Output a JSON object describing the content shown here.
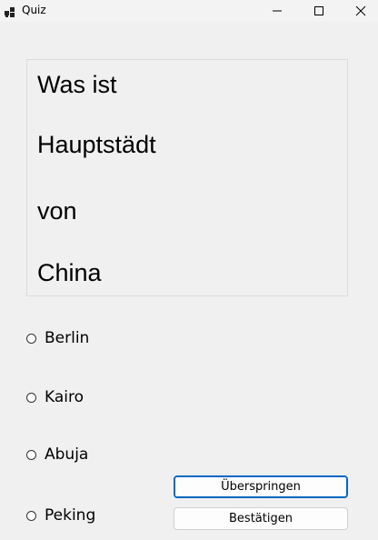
{
  "window": {
    "title": "Quiz"
  },
  "question": {
    "lines": [
      "Was ist",
      "Hauptstädt",
      "von",
      "China"
    ]
  },
  "options": [
    {
      "label": "Berlin"
    },
    {
      "label": "Kairo"
    },
    {
      "label": "Abuja"
    },
    {
      "label": "Peking"
    }
  ],
  "buttons": {
    "skip_label": "Überspringen",
    "confirm_label": "Bestätigen"
  },
  "colors": {
    "accent": "#0067c0"
  }
}
